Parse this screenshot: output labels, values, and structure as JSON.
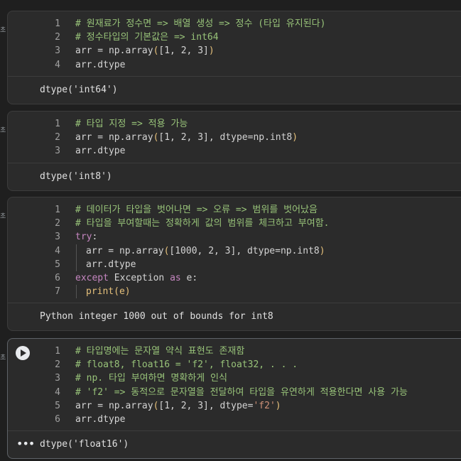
{
  "cells": [
    {
      "gutter": "초",
      "lines": [
        {
          "n": "1",
          "parts": [
            {
              "t": "# 원재료가 정수면 => 배열 생성 => 정수 (타입 유지된다)",
              "c": "com"
            }
          ]
        },
        {
          "n": "2",
          "parts": [
            {
              "t": "# 정수타입의 기본값은 => int64",
              "c": "com"
            }
          ]
        },
        {
          "n": "3",
          "parts": [
            {
              "t": "arr = np.array",
              "c": ""
            },
            {
              "t": "(",
              "c": "br"
            },
            {
              "t": "[1, 2, 3]",
              "c": ""
            },
            {
              "t": ")",
              "c": "br"
            }
          ]
        },
        {
          "n": "4",
          "parts": [
            {
              "t": "arr.dtype",
              "c": ""
            }
          ]
        }
      ],
      "output": "dtype('int64')"
    },
    {
      "gutter": "초",
      "lines": [
        {
          "n": "1",
          "parts": [
            {
              "t": "# 타입 지정 => 적용 가능",
              "c": "com"
            }
          ]
        },
        {
          "n": "2",
          "parts": [
            {
              "t": "arr = np.array",
              "c": ""
            },
            {
              "t": "(",
              "c": "br"
            },
            {
              "t": "[1, 2, 3], dtype=np.int8",
              "c": ""
            },
            {
              "t": ")",
              "c": "br"
            }
          ]
        },
        {
          "n": "3",
          "parts": [
            {
              "t": "arr.dtype",
              "c": ""
            }
          ]
        }
      ],
      "output": "dtype('int8')"
    },
    {
      "gutter": "초",
      "lines": [
        {
          "n": "1",
          "parts": [
            {
              "t": "# 데이터가 타입을 벗어나면 => 오류 => 범위를 벗어났음",
              "c": "com"
            }
          ]
        },
        {
          "n": "2",
          "parts": [
            {
              "t": "# 타입을 부여할때는 정확하게 값의 범위를 체크하고 부여함.",
              "c": "com"
            }
          ]
        },
        {
          "n": "3",
          "parts": [
            {
              "t": "try",
              "c": "kw"
            },
            {
              "t": ":",
              "c": ""
            }
          ]
        },
        {
          "n": "4",
          "indent": true,
          "parts": [
            {
              "t": "arr = np.array",
              "c": ""
            },
            {
              "t": "(",
              "c": "br"
            },
            {
              "t": "[1000, 2, 3], dtype=np.int8",
              "c": ""
            },
            {
              "t": ")",
              "c": "br"
            }
          ]
        },
        {
          "n": "5",
          "indent": true,
          "parts": [
            {
              "t": "arr.dtype",
              "c": ""
            }
          ]
        },
        {
          "n": "6",
          "parts": [
            {
              "t": "except",
              "c": "kw"
            },
            {
              "t": " Exception ",
              "c": ""
            },
            {
              "t": "as",
              "c": "kw"
            },
            {
              "t": " e:",
              "c": ""
            }
          ]
        },
        {
          "n": "7",
          "indent": true,
          "parts": [
            {
              "t": "print",
              "c": "br"
            },
            {
              "t": "(e)",
              "c": "br"
            }
          ]
        }
      ],
      "output": "Python integer 1000 out of bounds for int8"
    },
    {
      "gutter": "초",
      "active": true,
      "lines": [
        {
          "n": "1",
          "parts": [
            {
              "t": "# 타입명에는 문자열 약식 표현도 존재함",
              "c": "com"
            }
          ]
        },
        {
          "n": "2",
          "parts": [
            {
              "t": "# float8, float16 = 'f2', float32, . . .",
              "c": "com"
            }
          ]
        },
        {
          "n": "3",
          "parts": [
            {
              "t": "# np. 타입 부여하면 명확하게 인식",
              "c": "com"
            }
          ]
        },
        {
          "n": "4",
          "parts": [
            {
              "t": "# 'f2' => 동적으로 문자열을 전달하여 타입을 유연하게 적용한다면 사용 가능",
              "c": "com"
            }
          ]
        },
        {
          "n": "5",
          "parts": [
            {
              "t": "arr = np.array",
              "c": ""
            },
            {
              "t": "(",
              "c": "br"
            },
            {
              "t": "[1, 2, 3], dtype=",
              "c": ""
            },
            {
              "t": "'f2'",
              "c": "str"
            },
            {
              "t": ")",
              "c": "br"
            }
          ]
        },
        {
          "n": "6",
          "parts": [
            {
              "t": "arr.dtype",
              "c": ""
            }
          ]
        }
      ],
      "output": "dtype('float16')"
    }
  ],
  "icons": {
    "run": "play-circle-icon",
    "more": "more-horizontal-icon"
  }
}
